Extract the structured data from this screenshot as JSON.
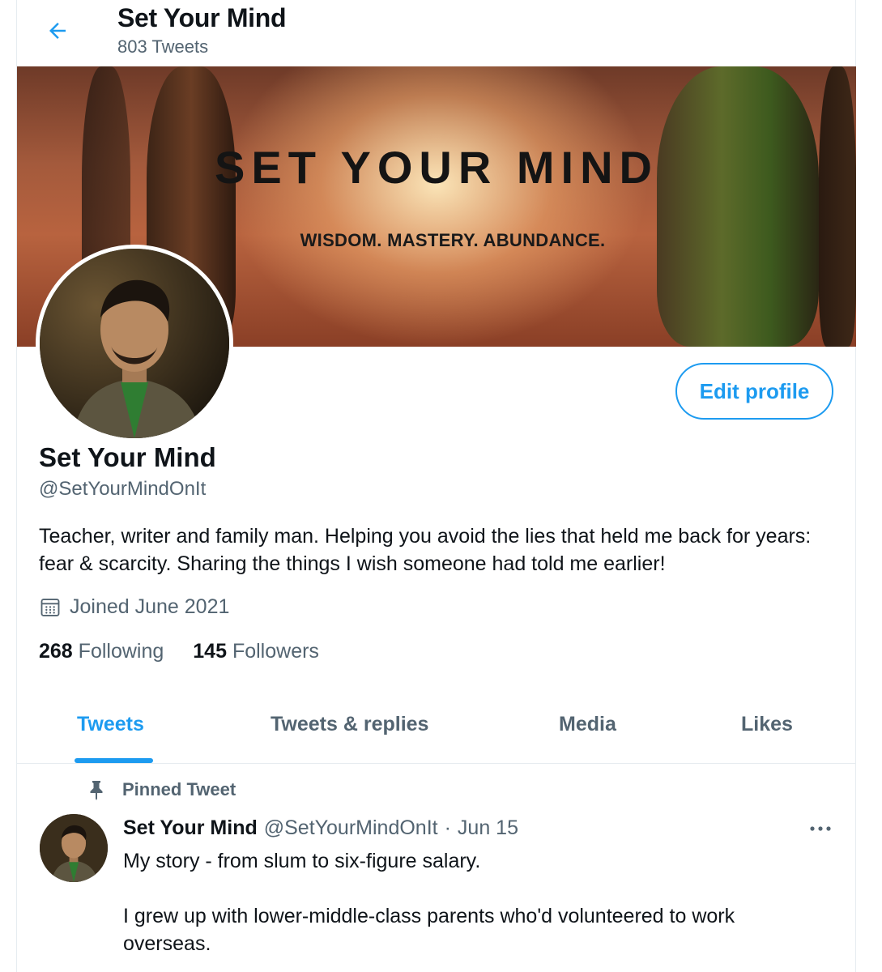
{
  "header": {
    "title": "Set Your Mind",
    "tweet_count": "803 Tweets",
    "back_icon": "arrow-left-icon"
  },
  "banner": {
    "title": "SET YOUR MIND",
    "subtitle": "WISDOM. MASTERY. ABUNDANCE."
  },
  "profile": {
    "name": "Set Your Mind",
    "handle": "@SetYourMindOnIt",
    "bio": "Teacher, writer and family man. Helping you avoid the lies that held me back for years: fear & scarcity. Sharing the things I wish someone had told me earlier!",
    "joined": "Joined June 2021",
    "following_count": "268",
    "following_label": "Following",
    "followers_count": "145",
    "followers_label": "Followers",
    "edit_label": "Edit profile"
  },
  "tabs": [
    {
      "label": "Tweets",
      "active": true
    },
    {
      "label": "Tweets & replies",
      "active": false
    },
    {
      "label": "Media",
      "active": false
    },
    {
      "label": "Likes",
      "active": false
    }
  ],
  "pinned_tweet": {
    "pinned_label": "Pinned Tweet",
    "author_name": "Set Your Mind",
    "author_handle": "@SetYourMindOnIt",
    "separator": "·",
    "date": "Jun 15",
    "text": "My story - from slum to six-figure salary.\n\nI grew up with lower-middle-class parents who'd volunteered to work overseas."
  },
  "colors": {
    "accent": "#1d9bf0",
    "secondary_text": "#536471",
    "primary_text": "#0f1419"
  }
}
